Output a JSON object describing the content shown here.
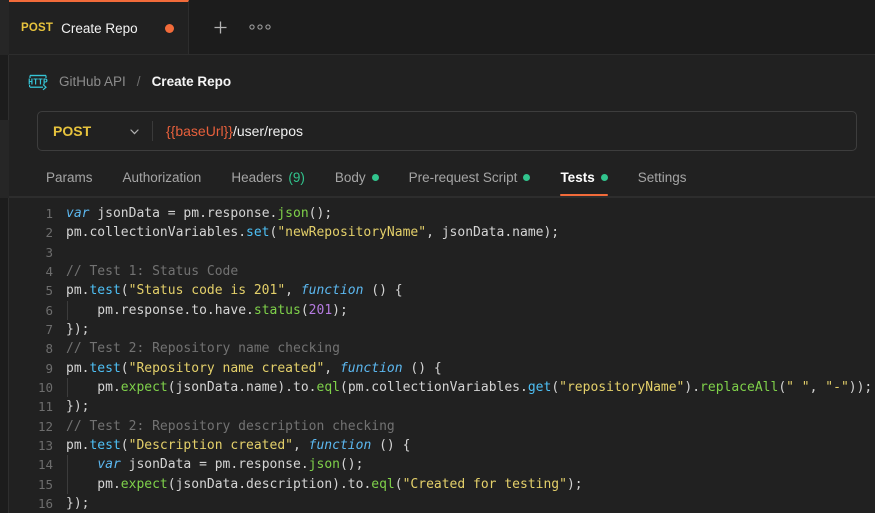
{
  "tab": {
    "method": "POST",
    "title": "Create Repo",
    "unsaved_dot": "unsaved-indicator",
    "new_tab_icon": "+",
    "more_icon": "●●●"
  },
  "breadcrumb": {
    "icon_label": "HTTP",
    "collection": "GitHub API",
    "separator": "/",
    "request": "Create Repo"
  },
  "request": {
    "method": "POST",
    "url_variable": "{{baseUrl}}",
    "url_path": "/user/repos"
  },
  "subtabs": [
    {
      "label": "Params",
      "active": false,
      "dot": false,
      "count": ""
    },
    {
      "label": "Authorization",
      "active": false,
      "dot": false,
      "count": ""
    },
    {
      "label": "Headers",
      "active": false,
      "dot": false,
      "count": "(9)"
    },
    {
      "label": "Body",
      "active": false,
      "dot": true,
      "count": ""
    },
    {
      "label": "Pre-request Script",
      "active": false,
      "dot": true,
      "count": ""
    },
    {
      "label": "Tests",
      "active": true,
      "dot": true,
      "count": ""
    },
    {
      "label": "Settings",
      "active": false,
      "dot": false,
      "count": ""
    }
  ],
  "colors": {
    "accent": "#f26b3a",
    "method": "#e7c33d",
    "green": "#31c48d",
    "bg": "#212121",
    "tabbar_bg": "#1c1c1c"
  },
  "editor": {
    "line_numbers": [
      1,
      2,
      3,
      4,
      5,
      6,
      7,
      8,
      9,
      10,
      11,
      12,
      13,
      14,
      15,
      16
    ],
    "lines": [
      {
        "n": 1,
        "indent": false,
        "text": "var jsonData = pm.response.json();"
      },
      {
        "n": 2,
        "indent": false,
        "text": "pm.collectionVariables.set(\"newRepositoryName\", jsonData.name);"
      },
      {
        "n": 3,
        "indent": false,
        "text": ""
      },
      {
        "n": 4,
        "indent": false,
        "text": "// Test 1: Status Code"
      },
      {
        "n": 5,
        "indent": false,
        "text": "pm.test(\"Status code is 201\", function () {"
      },
      {
        "n": 6,
        "indent": true,
        "text": "    pm.response.to.have.status(201);"
      },
      {
        "n": 7,
        "indent": false,
        "text": "});"
      },
      {
        "n": 8,
        "indent": false,
        "text": "// Test 2: Repository name checking"
      },
      {
        "n": 9,
        "indent": false,
        "text": "pm.test(\"Repository name created\", function () {"
      },
      {
        "n": 10,
        "indent": true,
        "text": "    pm.expect(jsonData.name).to.eql(pm.collectionVariables.get(\"repositoryName\").replaceAll(\" \", \"-\"));"
      },
      {
        "n": 11,
        "indent": false,
        "text": "});"
      },
      {
        "n": 12,
        "indent": false,
        "text": "// Test 2: Repository description checking"
      },
      {
        "n": 13,
        "indent": false,
        "text": "pm.test(\"Description created\", function () {"
      },
      {
        "n": 14,
        "indent": true,
        "text": "    var jsonData = pm.response.json();"
      },
      {
        "n": 15,
        "indent": true,
        "text": "    pm.expect(jsonData.description).to.eql(\"Created for testing\");"
      },
      {
        "n": 16,
        "indent": false,
        "text": "});"
      }
    ],
    "tokens": {
      "l1": [
        [
          "var ",
          "t-kw"
        ],
        [
          "jsonData ",
          "t-plain"
        ],
        [
          "= ",
          "t-op"
        ],
        [
          "pm",
          "t-plain"
        ],
        [
          ".",
          "t-punc"
        ],
        [
          "response",
          "t-plain"
        ],
        [
          ".",
          "t-punc"
        ],
        [
          "json",
          "t-fn2"
        ],
        [
          "();",
          "t-punc"
        ]
      ],
      "l2": [
        [
          "pm",
          "t-plain"
        ],
        [
          ".",
          "t-punc"
        ],
        [
          "collectionVariables",
          "t-plain"
        ],
        [
          ".",
          "t-punc"
        ],
        [
          "set",
          "t-fn"
        ],
        [
          "(",
          "t-punc"
        ],
        [
          "\"newRepositoryName\"",
          "t-str"
        ],
        [
          ", ",
          "t-punc"
        ],
        [
          "jsonData",
          "t-plain"
        ],
        [
          ".",
          "t-punc"
        ],
        [
          "name",
          "t-plain"
        ],
        [
          ");",
          "t-punc"
        ]
      ],
      "l3": [],
      "l4": [
        [
          "// Test 1: Status Code",
          "t-cmt"
        ]
      ],
      "l5": [
        [
          "pm",
          "t-plain"
        ],
        [
          ".",
          "t-punc"
        ],
        [
          "test",
          "t-fn"
        ],
        [
          "(",
          "t-punc"
        ],
        [
          "\"Status code is 201\"",
          "t-str"
        ],
        [
          ", ",
          "t-punc"
        ],
        [
          "function",
          "t-kw"
        ],
        [
          " () {",
          "t-punc"
        ]
      ],
      "l6": [
        [
          "    pm",
          "t-plain"
        ],
        [
          ".",
          "t-punc"
        ],
        [
          "response",
          "t-plain"
        ],
        [
          ".",
          "t-punc"
        ],
        [
          "to",
          "t-plain"
        ],
        [
          ".",
          "t-punc"
        ],
        [
          "have",
          "t-plain"
        ],
        [
          ".",
          "t-punc"
        ],
        [
          "status",
          "t-fn2"
        ],
        [
          "(",
          "t-punc"
        ],
        [
          "201",
          "t-num"
        ],
        [
          ");",
          "t-punc"
        ]
      ],
      "l7": [
        [
          "});",
          "t-punc"
        ]
      ],
      "l8": [
        [
          "// Test 2: Repository name checking",
          "t-cmt"
        ]
      ],
      "l9": [
        [
          "pm",
          "t-plain"
        ],
        [
          ".",
          "t-punc"
        ],
        [
          "test",
          "t-fn"
        ],
        [
          "(",
          "t-punc"
        ],
        [
          "\"Repository name created\"",
          "t-str"
        ],
        [
          ", ",
          "t-punc"
        ],
        [
          "function",
          "t-kw"
        ],
        [
          " () {",
          "t-punc"
        ]
      ],
      "l10": [
        [
          "    pm",
          "t-plain"
        ],
        [
          ".",
          "t-punc"
        ],
        [
          "expect",
          "t-fn2"
        ],
        [
          "(",
          "t-punc"
        ],
        [
          "jsonData",
          "t-plain"
        ],
        [
          ".",
          "t-punc"
        ],
        [
          "name",
          "t-plain"
        ],
        [
          ").",
          "t-punc"
        ],
        [
          "to",
          "t-plain"
        ],
        [
          ".",
          "t-punc"
        ],
        [
          "eql",
          "t-fn2"
        ],
        [
          "(",
          "t-punc"
        ],
        [
          "pm",
          "t-plain"
        ],
        [
          ".",
          "t-punc"
        ],
        [
          "collectionVariables",
          "t-plain"
        ],
        [
          ".",
          "t-punc"
        ],
        [
          "get",
          "t-fn"
        ],
        [
          "(",
          "t-punc"
        ],
        [
          "\"repositoryName\"",
          "t-str"
        ],
        [
          ").",
          "t-punc"
        ],
        [
          "replaceAll",
          "t-fn2"
        ],
        [
          "(",
          "t-punc"
        ],
        [
          "\" \"",
          "t-str"
        ],
        [
          ", ",
          "t-punc"
        ],
        [
          "\"-\"",
          "t-str"
        ],
        [
          "));",
          "t-punc"
        ]
      ],
      "l11": [
        [
          "});",
          "t-punc"
        ]
      ],
      "l12": [
        [
          "// Test 2: Repository description checking",
          "t-cmt"
        ]
      ],
      "l13": [
        [
          "pm",
          "t-plain"
        ],
        [
          ".",
          "t-punc"
        ],
        [
          "test",
          "t-fn"
        ],
        [
          "(",
          "t-punc"
        ],
        [
          "\"Description created\"",
          "t-str"
        ],
        [
          ", ",
          "t-punc"
        ],
        [
          "function",
          "t-kw"
        ],
        [
          " () {",
          "t-punc"
        ]
      ],
      "l14": [
        [
          "    ",
          "t-plain"
        ],
        [
          "var ",
          "t-kw"
        ],
        [
          "jsonData ",
          "t-plain"
        ],
        [
          "= ",
          "t-op"
        ],
        [
          "pm",
          "t-plain"
        ],
        [
          ".",
          "t-punc"
        ],
        [
          "response",
          "t-plain"
        ],
        [
          ".",
          "t-punc"
        ],
        [
          "json",
          "t-fn2"
        ],
        [
          "();",
          "t-punc"
        ]
      ],
      "l15": [
        [
          "    pm",
          "t-plain"
        ],
        [
          ".",
          "t-punc"
        ],
        [
          "expect",
          "t-fn2"
        ],
        [
          "(",
          "t-punc"
        ],
        [
          "jsonData",
          "t-plain"
        ],
        [
          ".",
          "t-punc"
        ],
        [
          "description",
          "t-plain"
        ],
        [
          ").",
          "t-punc"
        ],
        [
          "to",
          "t-plain"
        ],
        [
          ".",
          "t-punc"
        ],
        [
          "eql",
          "t-fn2"
        ],
        [
          "(",
          "t-punc"
        ],
        [
          "\"Created for testing\"",
          "t-str"
        ],
        [
          ");",
          "t-punc"
        ]
      ],
      "l16": [
        [
          "});",
          "t-punc"
        ]
      ]
    }
  }
}
